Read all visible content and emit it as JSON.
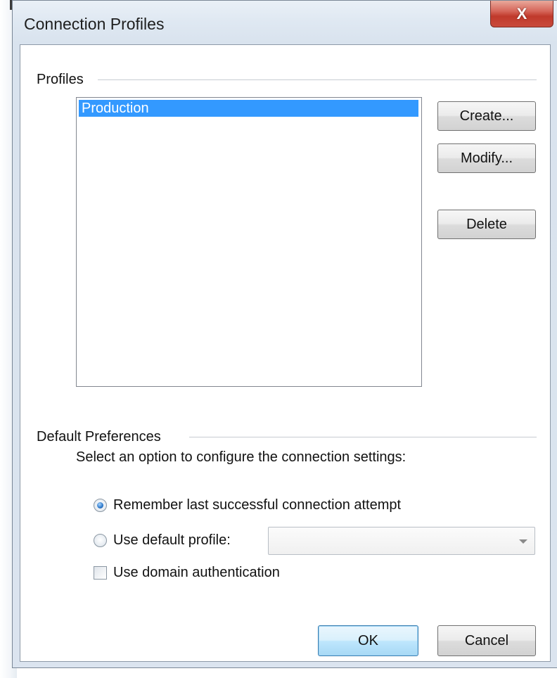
{
  "window": {
    "title": "Connection Profiles",
    "close_glyph": "X",
    "close_icon": "close-x-icon"
  },
  "profiles": {
    "group_label": "Profiles",
    "items": [
      {
        "label": "Production",
        "selected": true
      }
    ],
    "buttons": {
      "create": "Create...",
      "modify": "Modify...",
      "delete": "Delete"
    }
  },
  "default_preferences": {
    "group_label": "Default Preferences",
    "prompt": "Select an option to configure the connection settings:",
    "options": {
      "remember_last": {
        "label": "Remember last successful connection attempt",
        "checked": true
      },
      "use_default_profile": {
        "label": "Use default profile:",
        "checked": false
      }
    },
    "default_profile_select": {
      "value": "",
      "enabled": false
    },
    "domain_auth": {
      "label": "Use domain authentication",
      "checked": false
    }
  },
  "footer": {
    "ok": "OK",
    "cancel": "Cancel"
  },
  "colors": {
    "selection": "#3399ff",
    "close_button": "#c0392b",
    "window_frame": "#dbe4ef"
  }
}
